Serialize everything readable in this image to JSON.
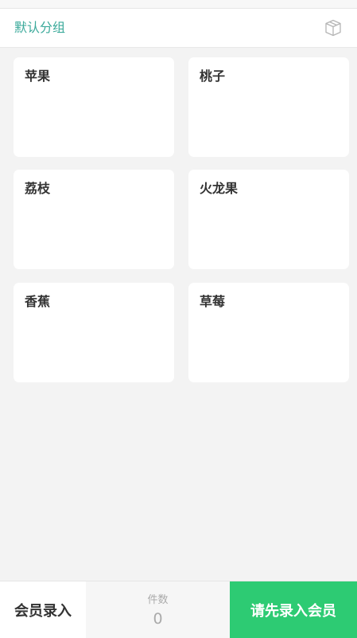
{
  "header": {
    "group_title": "默认分组",
    "box_icon": "package-box-icon"
  },
  "products": [
    {
      "name": "苹果"
    },
    {
      "name": "桃子"
    },
    {
      "name": "荔枝"
    },
    {
      "name": "火龙果"
    },
    {
      "name": "香蕉"
    },
    {
      "name": "草莓"
    }
  ],
  "footer": {
    "member_label": "会员录入",
    "count_label": "件数",
    "count_value": "0",
    "submit_label": "请先录入会员"
  },
  "colors": {
    "accent_teal": "#3aa99a",
    "submit_green": "#2dcb73",
    "background": "#f3f3f3"
  }
}
